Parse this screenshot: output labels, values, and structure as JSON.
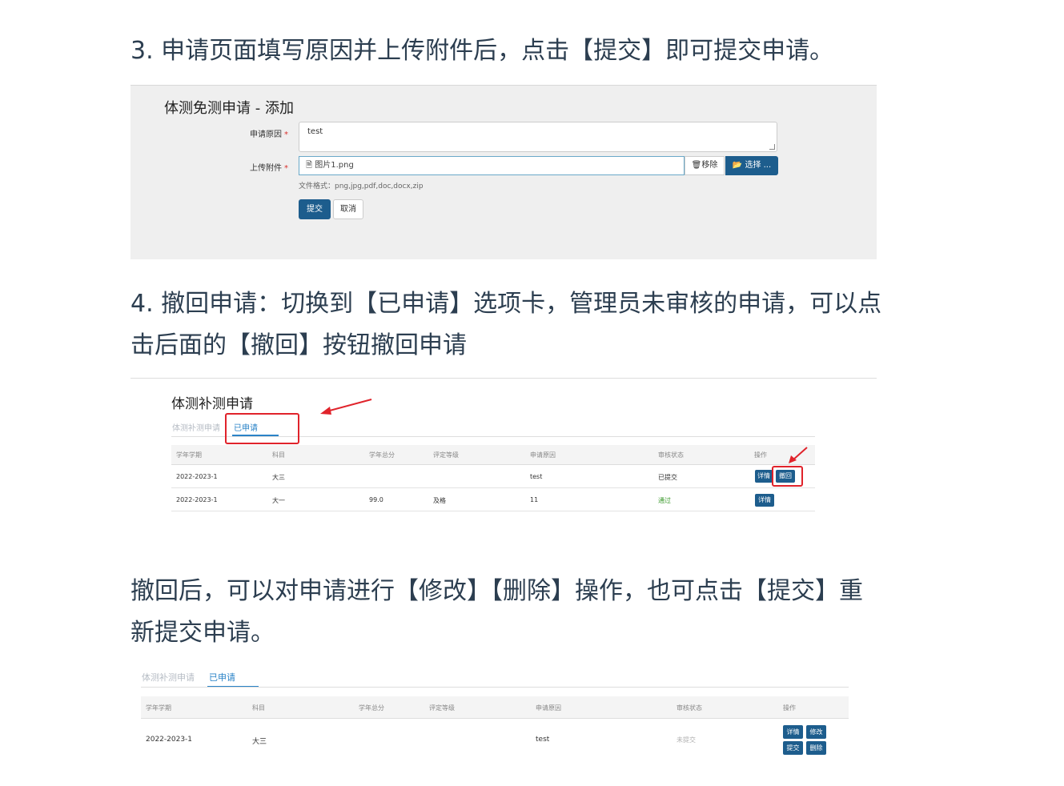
{
  "step3": {
    "heading": "3. 申请页面填写原因并上传附件后，点击【提交】即可提交申请。",
    "form": {
      "title": "体测免测申请 - 添加",
      "reason_label": "申请原因",
      "reason_value": "test",
      "attach_label": "上传附件",
      "required_mark": "*",
      "file_name": "图片1.png",
      "remove_label": "移除",
      "choose_label": "选择 ...",
      "hint": "文件格式：png,jpg,pdf,doc,docx,zip",
      "submit_label": "提交",
      "cancel_label": "取消"
    }
  },
  "step4": {
    "heading": "4. 撤回申请：切换到【已申请】选项卡，管理员未审核的申请，可以点击后面的【撤回】按钮撤回申请",
    "panel_title": "体测补测申请",
    "tabs": [
      "体测补测申请",
      "已申请"
    ],
    "columns": [
      "学年学期",
      "科目",
      "学年总分",
      "评定等级",
      "申请原因",
      "审核状态",
      "操作"
    ],
    "rows": [
      {
        "term": "2022-2023-1",
        "subject": "大三",
        "score": "",
        "grade": "",
        "reason": "test",
        "status": "已提交",
        "actions": [
          "详情",
          "撤回"
        ]
      },
      {
        "term": "2022-2023-1",
        "subject": "大一",
        "score": "99.0",
        "grade": "及格",
        "reason": "11",
        "status": "通过",
        "actions": [
          "详情"
        ]
      }
    ],
    "status_colors": {
      "passed": "#3c9a2e"
    }
  },
  "step5": {
    "heading": "撤回后，可以对申请进行【修改】【删除】操作，也可点击【提交】重新提交申请。",
    "tabs": [
      "体测补测申请",
      "已申请"
    ],
    "columns": [
      "学年学期",
      "科目",
      "学年总分",
      "评定等级",
      "申请原因",
      "审核状态",
      "操作"
    ],
    "row": {
      "term": "2022-2023-1",
      "subject": "大三",
      "score": "",
      "grade": "",
      "reason": "test",
      "status": "未提交",
      "actions": [
        "详情",
        "修改",
        "提交",
        "删除"
      ]
    }
  }
}
